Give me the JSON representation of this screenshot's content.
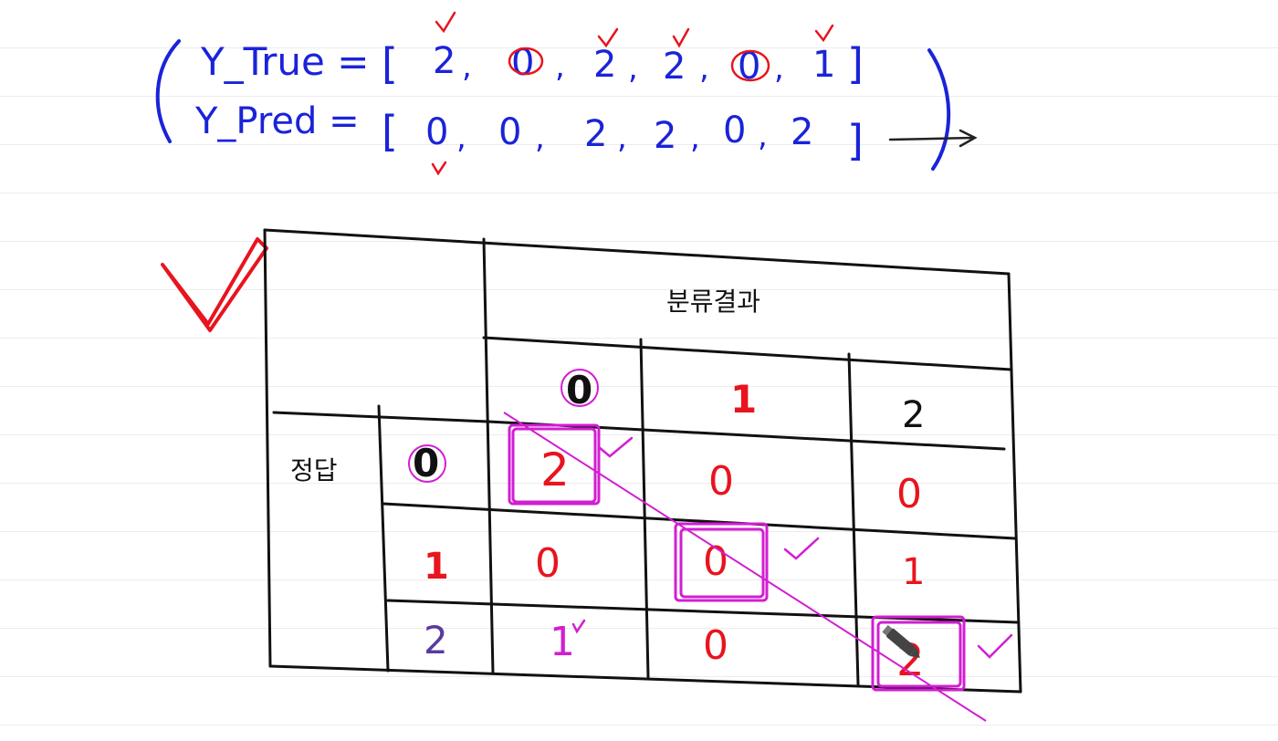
{
  "equations": {
    "true_label": "Y_True =",
    "pred_label": "Y_Pred =",
    "y_true": [
      "2",
      "0",
      "2",
      "2",
      "0",
      "1"
    ],
    "y_pred": [
      "0",
      "0",
      "2",
      "2",
      "0",
      "2"
    ]
  },
  "matrix": {
    "predicted_header": "분류결과",
    "actual_header": "정답",
    "col_labels": [
      "0",
      "1",
      "2"
    ],
    "row_labels": [
      "0",
      "1",
      "2"
    ],
    "cells": [
      [
        "2",
        "0",
        "0"
      ],
      [
        "0",
        "0",
        "1"
      ],
      [
        "1",
        "0",
        "2"
      ]
    ]
  },
  "colors": {
    "ink_blue": "#1a23d9",
    "ink_red": "#e8141e",
    "ink_magenta": "#d21ed2",
    "ink_black": "#111111"
  },
  "icons": [
    "check-mark-icon",
    "pen-cursor-icon",
    "arrow-right-icon"
  ]
}
